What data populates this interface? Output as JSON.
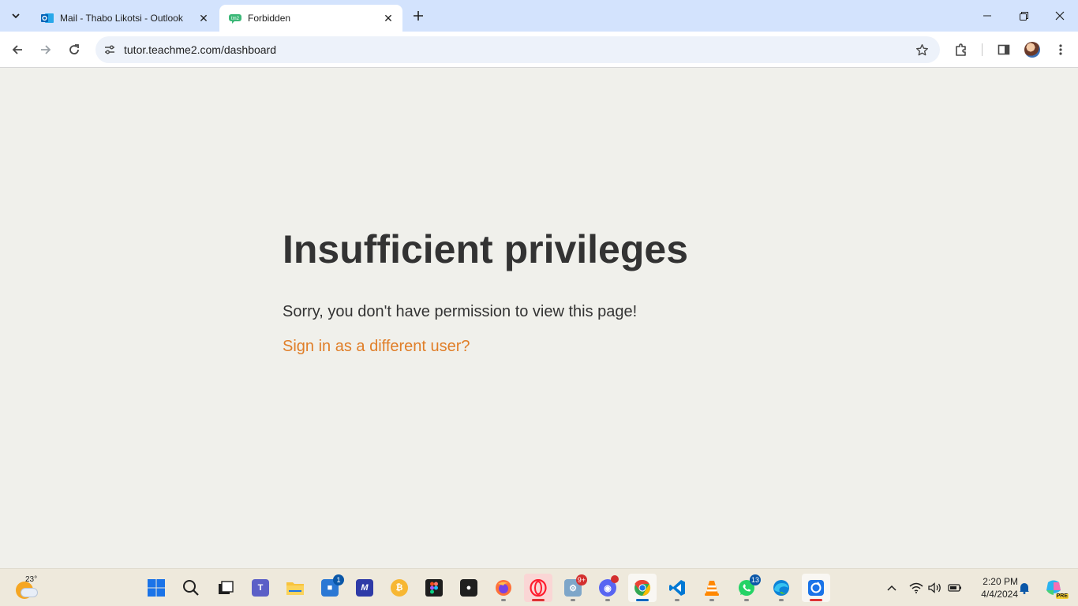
{
  "browser": {
    "tabs": [
      {
        "title": "Mail - Thabo Likotsi - Outlook",
        "favicon": "outlook-icon",
        "active": false
      },
      {
        "title": "Forbidden",
        "favicon": "teachme2-icon",
        "active": true
      }
    ],
    "url": "tutor.teachme2.com/dashboard"
  },
  "page": {
    "heading": "Insufficient privileges",
    "message": "Sorry, you don't have permission to view this page!",
    "signin_link": "Sign in as a different user?",
    "colors": {
      "background": "#f0f0eb",
      "text": "#333333",
      "link": "#e07e28"
    }
  },
  "taskbar": {
    "weather_temp": "23°",
    "apps": [
      {
        "name": "start",
        "icon": "windows-icon"
      },
      {
        "name": "search",
        "icon": "search-icon"
      },
      {
        "name": "task-view",
        "icon": "task-view-icon"
      },
      {
        "name": "teams",
        "icon": "teams-icon"
      },
      {
        "name": "file-explorer",
        "icon": "folder-icon"
      },
      {
        "name": "microsoft-store",
        "icon": "store-icon",
        "badge": "1"
      },
      {
        "name": "mathway",
        "icon": "mathway-icon"
      },
      {
        "name": "bitcoin",
        "icon": "bitcoin-icon"
      },
      {
        "name": "figma",
        "icon": "figma-icon"
      },
      {
        "name": "github",
        "icon": "github-icon"
      },
      {
        "name": "firefox",
        "icon": "firefox-icon"
      },
      {
        "name": "opera",
        "icon": "opera-icon"
      },
      {
        "name": "settings-app",
        "icon": "gear-app-icon",
        "badge": "9+"
      },
      {
        "name": "discord",
        "icon": "discord-icon"
      },
      {
        "name": "chrome",
        "icon": "chrome-icon"
      },
      {
        "name": "vscode",
        "icon": "vscode-icon"
      },
      {
        "name": "vlc",
        "icon": "vlc-icon"
      },
      {
        "name": "whatsapp",
        "icon": "whatsapp-icon",
        "badge": "13"
      },
      {
        "name": "edge",
        "icon": "edge-icon"
      },
      {
        "name": "snipping-tool",
        "icon": "snip-icon"
      }
    ],
    "time": "2:20 PM",
    "date": "4/4/2024",
    "copilot_badge": "PRE"
  }
}
